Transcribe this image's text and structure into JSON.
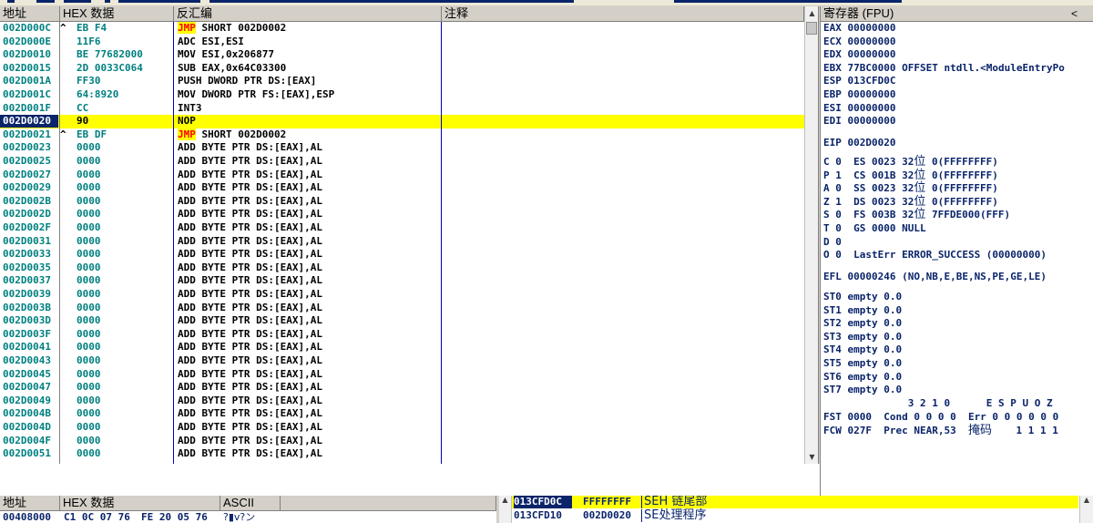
{
  "disasm": {
    "headers": {
      "addr": "地址",
      "hex": "HEX 数据",
      "asm": "反汇编",
      "comment": "注释"
    },
    "rows": [
      {
        "addr": "002D000C",
        "mark": "^",
        "hex": "EB F4",
        "mn": "JMP",
        "ops": " SHORT 002D0002",
        "jmp": true
      },
      {
        "addr": "002D000E",
        "mark": "",
        "hex": "11F6",
        "asm": "ADC ESI,ESI"
      },
      {
        "addr": "002D0010",
        "mark": "",
        "hex": "BE 77682000",
        "asm": "MOV ESI,0x206877"
      },
      {
        "addr": "002D0015",
        "mark": "",
        "hex": "2D 0033C064",
        "asm": "SUB EAX,0x64C03300"
      },
      {
        "addr": "002D001A",
        "mark": "",
        "hex": "FF30",
        "asm": "PUSH DWORD PTR DS:[EAX]"
      },
      {
        "addr": "002D001C",
        "mark": "",
        "hex": "64:8920",
        "asm": "MOV DWORD PTR FS:[EAX],ESP"
      },
      {
        "addr": "002D001F",
        "mark": "",
        "hex": "CC",
        "asm": "INT3"
      },
      {
        "addr": "002D0020",
        "mark": "",
        "hex": "90",
        "asm": "NOP",
        "selected": true
      },
      {
        "addr": "002D0021",
        "mark": "^",
        "hex": "EB DF",
        "mn": "JMP",
        "ops": " SHORT 002D0002",
        "jmp": true
      },
      {
        "addr": "002D0023",
        "mark": "",
        "hex": "0000",
        "asm": "ADD BYTE PTR DS:[EAX],AL"
      },
      {
        "addr": "002D0025",
        "mark": "",
        "hex": "0000",
        "asm": "ADD BYTE PTR DS:[EAX],AL"
      },
      {
        "addr": "002D0027",
        "mark": "",
        "hex": "0000",
        "asm": "ADD BYTE PTR DS:[EAX],AL"
      },
      {
        "addr": "002D0029",
        "mark": "",
        "hex": "0000",
        "asm": "ADD BYTE PTR DS:[EAX],AL"
      },
      {
        "addr": "002D002B",
        "mark": "",
        "hex": "0000",
        "asm": "ADD BYTE PTR DS:[EAX],AL"
      },
      {
        "addr": "002D002D",
        "mark": "",
        "hex": "0000",
        "asm": "ADD BYTE PTR DS:[EAX],AL"
      },
      {
        "addr": "002D002F",
        "mark": "",
        "hex": "0000",
        "asm": "ADD BYTE PTR DS:[EAX],AL"
      },
      {
        "addr": "002D0031",
        "mark": "",
        "hex": "0000",
        "asm": "ADD BYTE PTR DS:[EAX],AL"
      },
      {
        "addr": "002D0033",
        "mark": "",
        "hex": "0000",
        "asm": "ADD BYTE PTR DS:[EAX],AL"
      },
      {
        "addr": "002D0035",
        "mark": "",
        "hex": "0000",
        "asm": "ADD BYTE PTR DS:[EAX],AL"
      },
      {
        "addr": "002D0037",
        "mark": "",
        "hex": "0000",
        "asm": "ADD BYTE PTR DS:[EAX],AL"
      },
      {
        "addr": "002D0039",
        "mark": "",
        "hex": "0000",
        "asm": "ADD BYTE PTR DS:[EAX],AL"
      },
      {
        "addr": "002D003B",
        "mark": "",
        "hex": "0000",
        "asm": "ADD BYTE PTR DS:[EAX],AL"
      },
      {
        "addr": "002D003D",
        "mark": "",
        "hex": "0000",
        "asm": "ADD BYTE PTR DS:[EAX],AL"
      },
      {
        "addr": "002D003F",
        "mark": "",
        "hex": "0000",
        "asm": "ADD BYTE PTR DS:[EAX],AL"
      },
      {
        "addr": "002D0041",
        "mark": "",
        "hex": "0000",
        "asm": "ADD BYTE PTR DS:[EAX],AL"
      },
      {
        "addr": "002D0043",
        "mark": "",
        "hex": "0000",
        "asm": "ADD BYTE PTR DS:[EAX],AL"
      },
      {
        "addr": "002D0045",
        "mark": "",
        "hex": "0000",
        "asm": "ADD BYTE PTR DS:[EAX],AL"
      },
      {
        "addr": "002D0047",
        "mark": "",
        "hex": "0000",
        "asm": "ADD BYTE PTR DS:[EAX],AL"
      },
      {
        "addr": "002D0049",
        "mark": "",
        "hex": "0000",
        "asm": "ADD BYTE PTR DS:[EAX],AL"
      },
      {
        "addr": "002D004B",
        "mark": "",
        "hex": "0000",
        "asm": "ADD BYTE PTR DS:[EAX],AL"
      },
      {
        "addr": "002D004D",
        "mark": "",
        "hex": "0000",
        "asm": "ADD BYTE PTR DS:[EAX],AL"
      },
      {
        "addr": "002D004F",
        "mark": "",
        "hex": "0000",
        "asm": "ADD BYTE PTR DS:[EAX],AL"
      },
      {
        "addr": "002D0051",
        "mark": "",
        "hex": "0000",
        "asm": "ADD BYTE PTR DS:[EAX],AL"
      }
    ]
  },
  "registers": {
    "title": "寄存器 (FPU)",
    "collapse_glyph": "<",
    "gp": [
      {
        "text": "EAX 00000000"
      },
      {
        "text": "ECX 00000000"
      },
      {
        "text": "EDX 00000000"
      },
      {
        "text": "EBX 77BC0000 OFFSET ntdll.<ModuleEntryPo"
      },
      {
        "text": "ESP 013CFD0C"
      },
      {
        "text": "EBP 00000000"
      },
      {
        "text": "ESI 00000000"
      },
      {
        "text": "EDI 00000000"
      }
    ],
    "eip": "EIP 002D0020",
    "flags": [
      {
        "a": "C 0  ES 0023 32",
        "cj": "位",
        "b": " 0(FFFFFFFF)"
      },
      {
        "a": "P 1  CS 001B 32",
        "cj": "位",
        "b": " 0(FFFFFFFF)"
      },
      {
        "a": "A 0  SS 0023 32",
        "cj": "位",
        "b": " 0(FFFFFFFF)"
      },
      {
        "a": "Z 1  DS 0023 32",
        "cj": "位",
        "b": " 0(FFFFFFFF)"
      },
      {
        "a": "S 0  FS 003B 32",
        "cj": "位",
        "b": " 7FFDE000(FFF)"
      },
      {
        "a": "T 0  GS 0000 NULL",
        "cj": "",
        "b": ""
      },
      {
        "a": "D 0",
        "cj": "",
        "b": ""
      },
      {
        "a": "O 0  LastErr ERROR_SUCCESS (00000000)",
        "cj": "",
        "b": ""
      }
    ],
    "efl": "EFL 00000246 (NO,NB,E,BE,NS,PE,GE,LE)",
    "fpu": [
      "ST0 empty 0.0",
      "ST1 empty 0.0",
      "ST2 empty 0.0",
      "ST3 empty 0.0",
      "ST4 empty 0.0",
      "ST5 empty 0.0",
      "ST6 empty 0.0",
      "ST7 empty 0.0"
    ],
    "fst_header": "              3 2 1 0      E S P U O Z",
    "fst": "FST 0000  Cond 0 0 0 0  Err 0 0 0 0 0 0",
    "fcw_a": "FCW 027F  Prec NEAR,53  ",
    "fcw_cj": "掩码",
    "fcw_b": "    1 1 1 1"
  },
  "dump": {
    "headers": {
      "addr": "地址",
      "hex": "HEX 数据",
      "ascii": "ASCII"
    },
    "row": {
      "addr": "00408000",
      "hex": "C1 0C 07 76",
      "hex2": "FE 20 05 76",
      "ascii": "?▮v?ン"
    }
  },
  "stack": {
    "rows": [
      {
        "addr": "013CFD0C",
        "val": "FFFFFFFF",
        "cmt": "SEH 链尾部",
        "selected": true
      },
      {
        "addr": "013CFD10",
        "val": "002D0020",
        "cmt": "SE处理程序",
        "selected": false
      }
    ]
  }
}
